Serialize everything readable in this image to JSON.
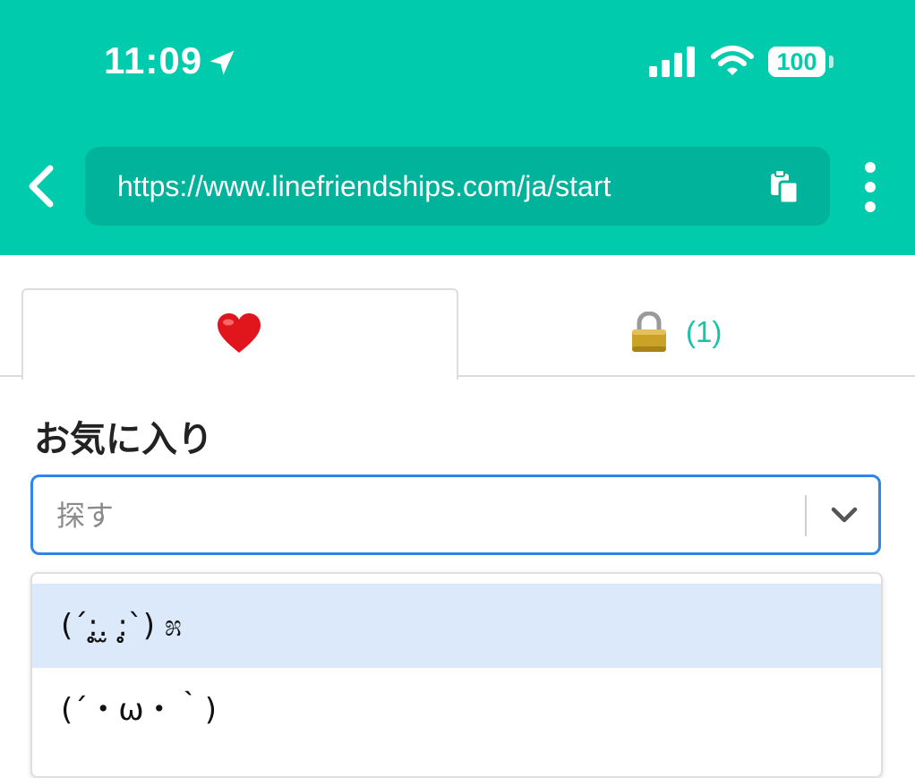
{
  "status_bar": {
    "time": "11:09",
    "battery": "100",
    "icons": [
      "location-arrow-icon",
      "signal-icon",
      "wifi-icon",
      "battery-icon"
    ]
  },
  "browser": {
    "url": "https://www.linefriendships.com/ja/start",
    "icons": [
      "back-chevron-icon",
      "copy-icon",
      "more-vertical-icon"
    ]
  },
  "tabs": [
    {
      "icon": "heart-icon",
      "label": "",
      "active": true
    },
    {
      "icon": "lock-icon",
      "count": "(1)",
      "active": false
    }
  ],
  "favorites": {
    "title": "お気に入り",
    "search": {
      "placeholder": "探す",
      "value": ""
    },
    "options": [
      {
        "text": "(´:̥̥̥̥̥̥̥̥.̫ :̥̥̥̥̥̥̥̥`) ೫",
        "highlighted": true
      },
      {
        "text": "(´・ω・｀)",
        "highlighted": false
      }
    ]
  },
  "colors": {
    "header_bg": "#00cbad",
    "url_bar_bg": "#00b39a",
    "accent_text": "#18c3a8",
    "focus_border": "#2e86e8",
    "option_highlight": "#dce9fb"
  }
}
